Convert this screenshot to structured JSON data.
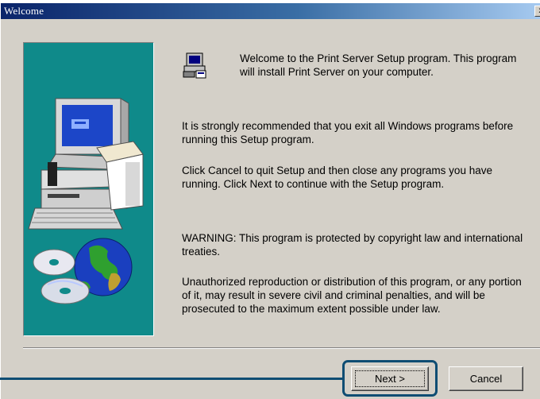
{
  "window": {
    "title": "Welcome",
    "close_label": "x"
  },
  "welcome_text": "Welcome to the Print Server Setup program.  This program will install Print Server on your computer.",
  "paragraphs": [
    "It is strongly recommended that you exit all Windows programs before running this Setup program.",
    "Click Cancel to quit Setup and then close any programs you have running.  Click Next to continue with the Setup program.",
    "WARNING: This program is protected by copyright law and international treaties.",
    "Unauthorized reproduction or distribution of this program, or any portion of it, may result in severe civil and criminal penalties, and will be prosecuted to the maximum extent possible under law."
  ],
  "buttons": {
    "next_label": "Next >",
    "cancel_label": "Cancel"
  },
  "icons": {
    "art_panel": "computer-cd-globe-illustration",
    "setup": "setup-computer-icon"
  },
  "colors": {
    "art_background": "#0f8a8a",
    "highlight": "#0f4d73",
    "titlebar": "#0a246a"
  }
}
